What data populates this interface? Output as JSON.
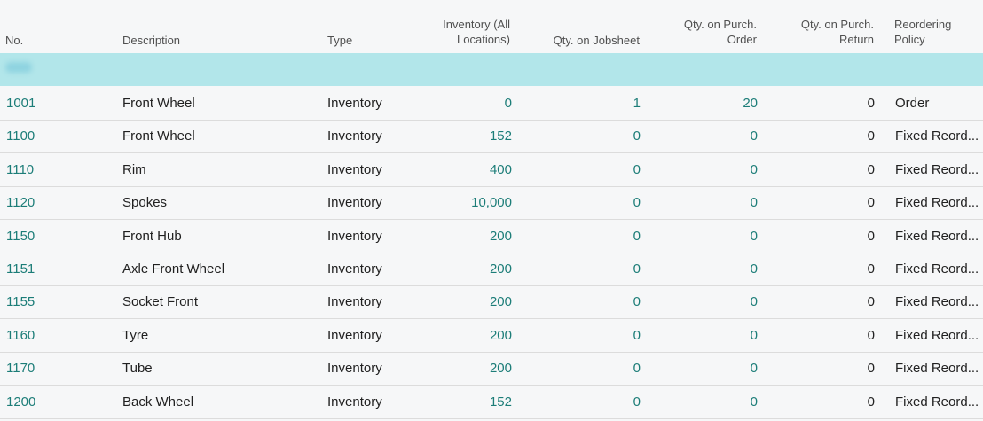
{
  "headers": {
    "no": "No.",
    "description": "Description",
    "type": "Type",
    "inventory_line1": "Inventory (All",
    "inventory_line2": "Locations)",
    "jobsheet": "Qty. on Jobsheet",
    "purch_order_line1": "Qty. on Purch.",
    "purch_order_line2": "Order",
    "purch_return_line1": "Qty. on Purch.",
    "purch_return_line2": "Return",
    "policy_line1": "Reordering",
    "policy_line2": "Policy"
  },
  "rows": [
    {
      "no": "1001",
      "description": "Front Wheel",
      "type": "Inventory",
      "inventory": "0",
      "jobsheet": "1",
      "purch_order": "20",
      "purch_return": "0",
      "policy": "Order"
    },
    {
      "no": "1100",
      "description": "Front Wheel",
      "type": "Inventory",
      "inventory": "152",
      "jobsheet": "0",
      "purch_order": "0",
      "purch_return": "0",
      "policy": "Fixed Reord..."
    },
    {
      "no": "1110",
      "description": "Rim",
      "type": "Inventory",
      "inventory": "400",
      "jobsheet": "0",
      "purch_order": "0",
      "purch_return": "0",
      "policy": "Fixed Reord..."
    },
    {
      "no": "1120",
      "description": "Spokes",
      "type": "Inventory",
      "inventory": "10,000",
      "jobsheet": "0",
      "purch_order": "0",
      "purch_return": "0",
      "policy": "Fixed Reord..."
    },
    {
      "no": "1150",
      "description": "Front Hub",
      "type": "Inventory",
      "inventory": "200",
      "jobsheet": "0",
      "purch_order": "0",
      "purch_return": "0",
      "policy": "Fixed Reord..."
    },
    {
      "no": "1151",
      "description": "Axle Front Wheel",
      "type": "Inventory",
      "inventory": "200",
      "jobsheet": "0",
      "purch_order": "0",
      "purch_return": "0",
      "policy": "Fixed Reord..."
    },
    {
      "no": "1155",
      "description": "Socket Front",
      "type": "Inventory",
      "inventory": "200",
      "jobsheet": "0",
      "purch_order": "0",
      "purch_return": "0",
      "policy": "Fixed Reord..."
    },
    {
      "no": "1160",
      "description": "Tyre",
      "type": "Inventory",
      "inventory": "200",
      "jobsheet": "0",
      "purch_order": "0",
      "purch_return": "0",
      "policy": "Fixed Reord..."
    },
    {
      "no": "1170",
      "description": "Tube",
      "type": "Inventory",
      "inventory": "200",
      "jobsheet": "0",
      "purch_order": "0",
      "purch_return": "0",
      "policy": "Fixed Reord..."
    },
    {
      "no": "1200",
      "description": "Back Wheel",
      "type": "Inventory",
      "inventory": "152",
      "jobsheet": "0",
      "purch_order": "0",
      "purch_return": "0",
      "policy": "Fixed Reord..."
    }
  ],
  "colors": {
    "link": "#1c7d78",
    "new_row": "#b2e6ea",
    "background": "#f6f7f8"
  }
}
